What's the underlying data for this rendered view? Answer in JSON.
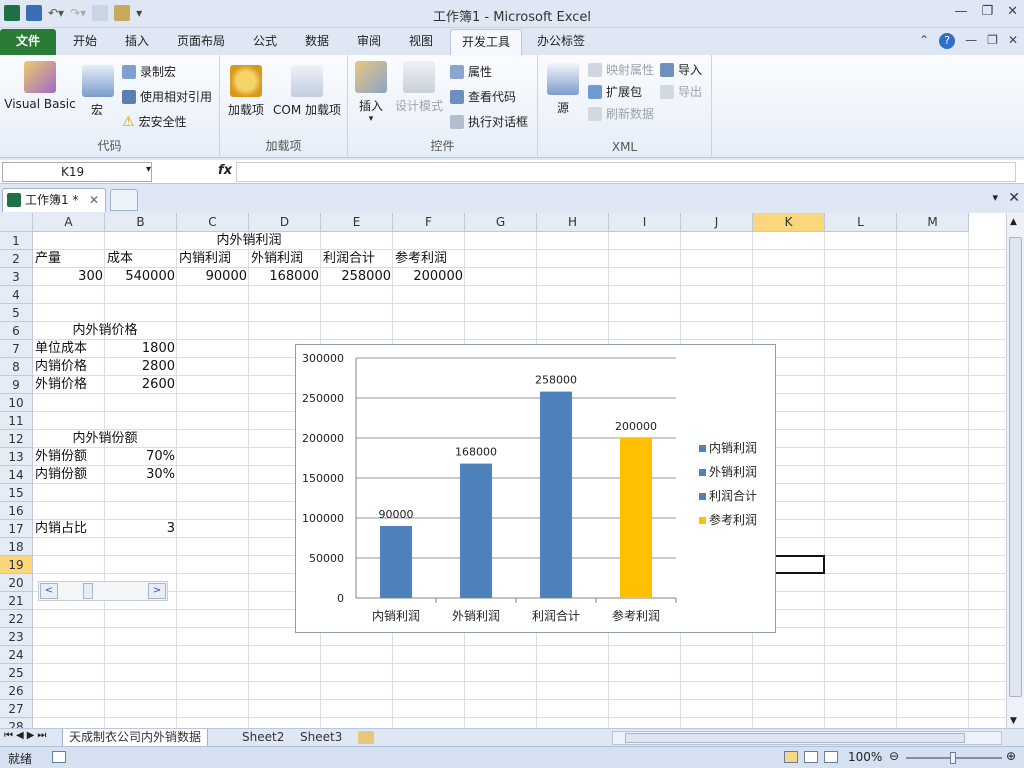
{
  "window": {
    "title": "工作簿1 - Microsoft Excel",
    "controls": [
      "—",
      "❐",
      "✕"
    ]
  },
  "ribbon_tabs": [
    "文件",
    "开始",
    "插入",
    "页面布局",
    "公式",
    "数据",
    "审阅",
    "视图",
    "开发工具",
    "办公标签"
  ],
  "active_tab": "开发工具",
  "ribbon": {
    "code": {
      "label": "代码",
      "visual_basic": "Visual Basic",
      "macros": "宏",
      "record_macro": "录制宏",
      "relative_ref": "使用相对引用",
      "macro_security": "宏安全性"
    },
    "addins": {
      "label": "加载项",
      "addins": "加载项",
      "com_addins": "COM 加载项"
    },
    "controls": {
      "label": "控件",
      "insert": "插入",
      "design_mode": "设计模式",
      "properties": "属性",
      "view_code": "查看代码",
      "run_dialog": "执行对话框"
    },
    "xml": {
      "label": "XML",
      "source": "源",
      "map_props": "映射属性",
      "expansion": "扩展包",
      "refresh": "刷新数据",
      "import": "导入",
      "export": "导出"
    }
  },
  "formula_bar": {
    "name_box": "K19",
    "fx": "fx",
    "formula": ""
  },
  "workbook_tab": "工作簿1 *",
  "columns": [
    "A",
    "B",
    "C",
    "D",
    "E",
    "F",
    "G",
    "H",
    "I",
    "J",
    "K",
    "L",
    "M"
  ],
  "selected_column": "K",
  "rows": [
    "1",
    "2",
    "3",
    "4",
    "5",
    "6",
    "7",
    "8",
    "9",
    "10",
    "11",
    "12",
    "13",
    "14",
    "15",
    "16",
    "17",
    "18",
    "19",
    "20",
    "21",
    "22",
    "23",
    "24",
    "25",
    "26",
    "27",
    "28"
  ],
  "selected_row": "19",
  "cells": {
    "C1": "内外销利润",
    "A2": "产量",
    "B2": "成本",
    "C2": "内销利润",
    "D2": "外销利润",
    "E2": "利润合计",
    "F2": "参考利润",
    "A3": "300",
    "B3": "540000",
    "C3": "90000",
    "D3": "168000",
    "E3": "258000",
    "F3": "200000",
    "A6": "内外销价格",
    "A7": "单位成本",
    "B7": "1800",
    "A8": "内销价格",
    "B8": "2800",
    "A9": "外销价格",
    "B9": "2600",
    "A12": "内外销份额",
    "A13": "外销份额",
    "B13": "70%",
    "A14": "内销份额",
    "B14": "30%",
    "A17": "内销占比",
    "B17": "3"
  },
  "scroll_control": {
    "left": "<",
    "right": ">"
  },
  "chart_data": {
    "type": "bar",
    "categories": [
      "内销利润",
      "外销利润",
      "利润合计",
      "参考利润"
    ],
    "values": [
      90000,
      168000,
      258000,
      200000
    ],
    "data_labels": [
      "90000",
      "168000",
      "258000",
      "200000"
    ],
    "colors": [
      "#4f81bd",
      "#4f81bd",
      "#4f81bd",
      "#ffc000"
    ],
    "ylim": [
      0,
      300000
    ],
    "yticks": [
      "0",
      "50000",
      "100000",
      "150000",
      "200000",
      "250000",
      "300000"
    ],
    "legend": [
      "内销利润",
      "外销利润",
      "利润合计",
      "参考利润"
    ],
    "legend_position": "right",
    "grid": true,
    "title": "",
    "xlabel": "",
    "ylabel": ""
  },
  "sheet_tabs": [
    "天成制衣公司内外销数据",
    "Sheet2",
    "Sheet3"
  ],
  "active_sheet": "天成制衣公司内外销数据",
  "status": {
    "ready": "就绪",
    "zoom": "100%"
  }
}
